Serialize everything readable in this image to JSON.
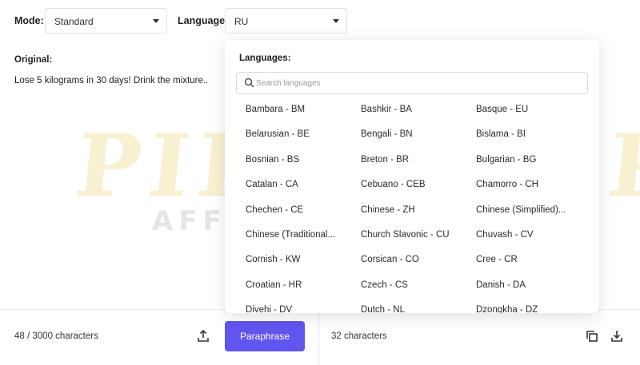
{
  "toolbar": {
    "mode_label": "Mode:",
    "mode_value": "Standard",
    "language_label": "Language:",
    "language_value": "RU"
  },
  "original": {
    "label": "Original:",
    "text": "Lose 5 kilograms in 30 days! Drink the mixture.."
  },
  "watermark": {
    "title": "PIRATE CPA",
    "subtitle": "AFFILIATE MARKETING"
  },
  "languages_dropdown": {
    "title": "Languages:",
    "search_placeholder": "Search languages",
    "rows": [
      [
        "Bambara - BM",
        "Bashkir - BA",
        "Basque - EU"
      ],
      [
        "Belarusian - BE",
        "Bengali - BN",
        "Bislama - BI"
      ],
      [
        "Bosnian - BS",
        "Breton - BR",
        "Bulgarian - BG"
      ],
      [
        "Catalan - CA",
        "Cebuano - CEB",
        "Chamorro - CH"
      ],
      [
        "Chechen - CE",
        "Chinese - ZH",
        "Chinese (Simplified)..."
      ],
      [
        "Chinese (Traditional...",
        "Church Slavonic - CU",
        "Chuvash - CV"
      ],
      [
        "Cornish - KW",
        "Corsican - CO",
        "Cree - CR"
      ],
      [
        "Croatian - HR",
        "Czech - CS",
        "Danish - DA"
      ],
      [
        "Divehi - DV",
        "Dutch - NL",
        "Dzongkha - DZ"
      ]
    ]
  },
  "footer": {
    "input_count": "48 / 3000 characters",
    "paraphrase_label": "Paraphrase",
    "output_count": "32 characters"
  },
  "colors": {
    "accent": "#6254ee",
    "watermark_gold": "#f3e6ad"
  },
  "icons": {
    "upload": "upload-icon",
    "copy": "copy-icon",
    "download": "download-icon",
    "search": "search-icon",
    "caret": "chevron-down-icon"
  }
}
